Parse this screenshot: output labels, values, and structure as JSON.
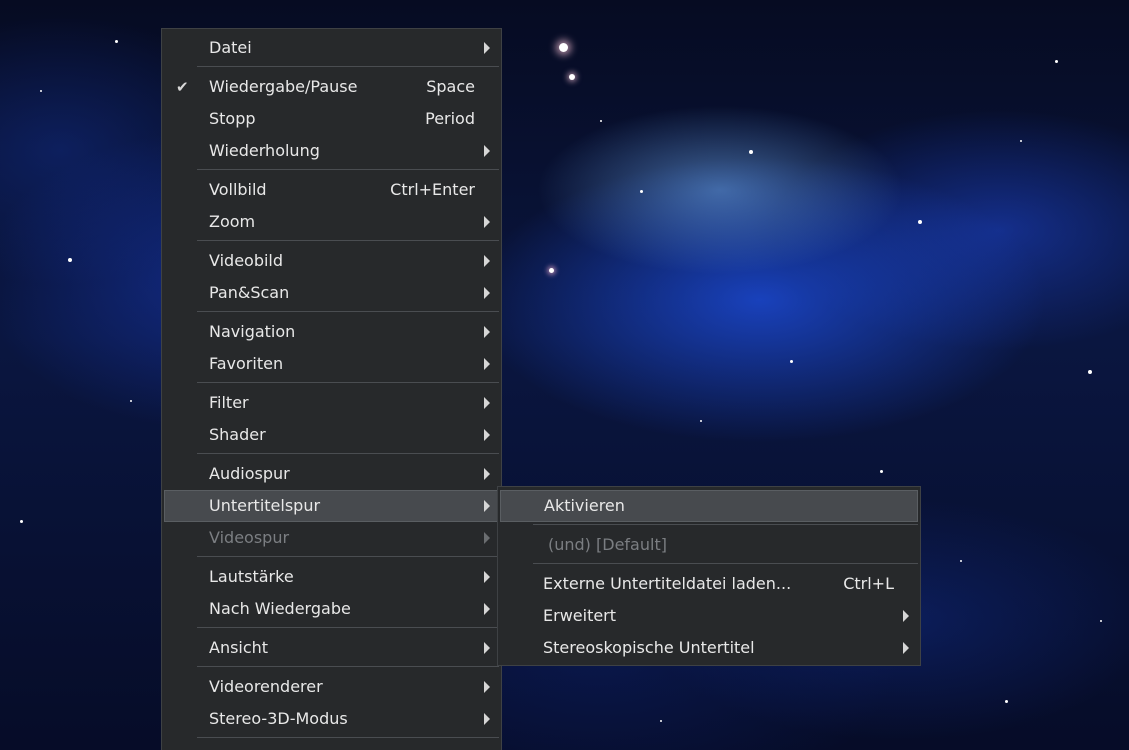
{
  "main_menu": {
    "items": [
      {
        "label": "Datei",
        "has_submenu": true
      },
      {
        "label": "Wiedergabe/Pause",
        "shortcut": "Space",
        "checked": true
      },
      {
        "label": "Stopp",
        "shortcut": "Period"
      },
      {
        "label": "Wiederholung",
        "has_submenu": true
      },
      {
        "label": "Vollbild",
        "shortcut": "Ctrl+Enter"
      },
      {
        "label": "Zoom",
        "has_submenu": true
      },
      {
        "label": "Videobild",
        "has_submenu": true
      },
      {
        "label": "Pan&Scan",
        "has_submenu": true
      },
      {
        "label": "Navigation",
        "has_submenu": true
      },
      {
        "label": "Favoriten",
        "has_submenu": true
      },
      {
        "label": "Filter",
        "has_submenu": true
      },
      {
        "label": "Shader",
        "has_submenu": true
      },
      {
        "label": "Audiospur",
        "has_submenu": true
      },
      {
        "label": "Untertitelspur",
        "has_submenu": true,
        "active": true
      },
      {
        "label": "Videospur",
        "has_submenu": true,
        "disabled": true
      },
      {
        "label": "Lautstärke",
        "has_submenu": true
      },
      {
        "label": "Nach Wiedergabe",
        "has_submenu": true
      },
      {
        "label": "Ansicht",
        "has_submenu": true
      },
      {
        "label": "Videorenderer",
        "has_submenu": true
      },
      {
        "label": "Stereo-3D-Modus",
        "has_submenu": true
      }
    ]
  },
  "subtitle_submenu": {
    "items": [
      {
        "label": "Aktivieren",
        "highlighted": true
      },
      {
        "label": "(und) [Default]",
        "disabled": true
      },
      {
        "label": "Externe Untertiteldatei laden...",
        "shortcut": "Ctrl+L"
      },
      {
        "label": "Erweitert",
        "has_submenu": true
      },
      {
        "label": "Stereoskopische Untertitel",
        "has_submenu": true
      }
    ]
  },
  "icons": {
    "check": "checkmark-icon",
    "submenu": "submenu-arrow-icon"
  },
  "colors": {
    "menu_bg": "#27292b",
    "highlight_bg": "#474a4e",
    "text": "#e8e8e8",
    "disabled_text": "#7b7e82"
  }
}
